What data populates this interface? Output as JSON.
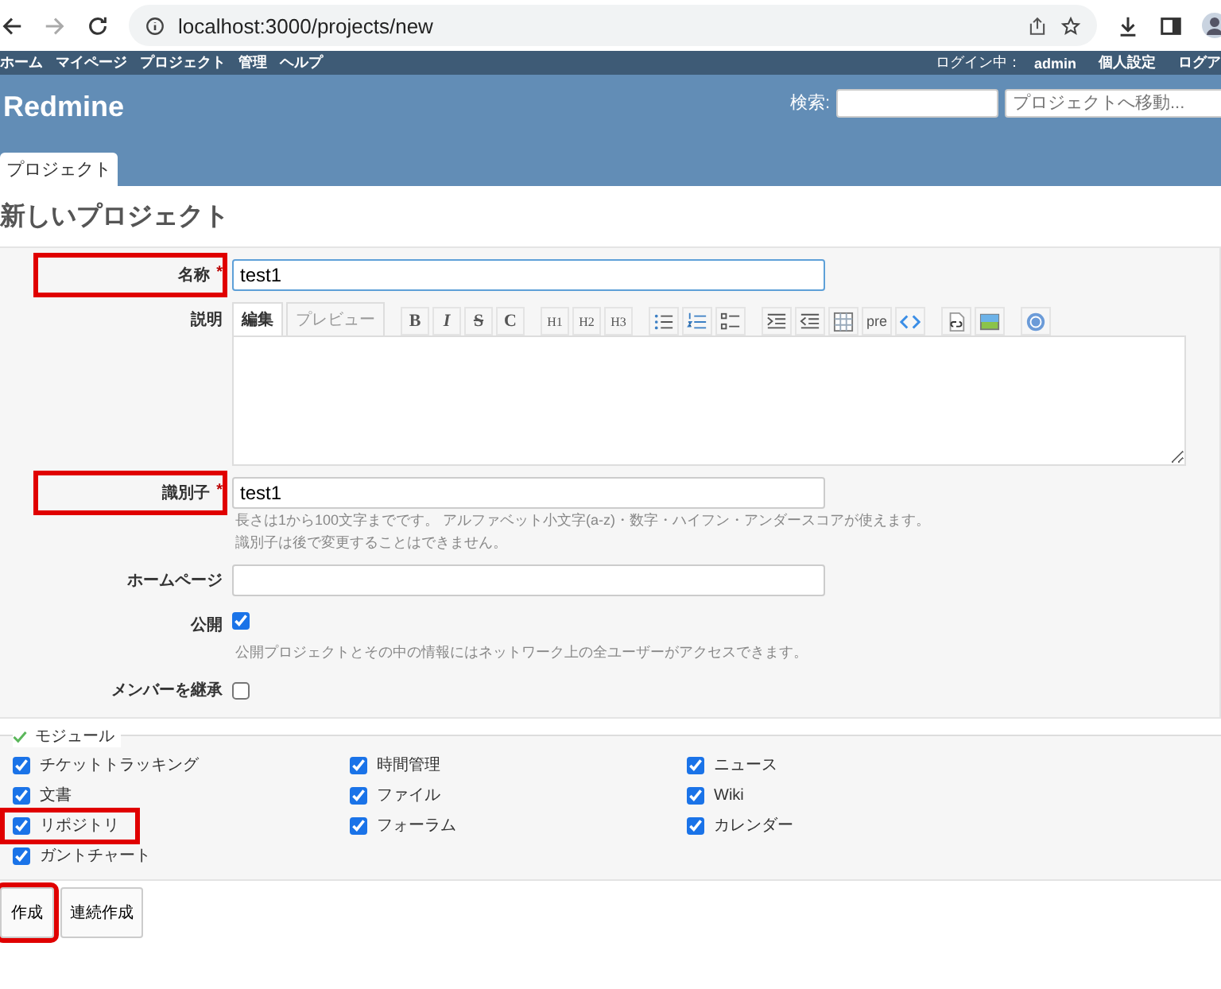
{
  "browser": {
    "url": "localhost:3000/projects/new"
  },
  "top_menu": {
    "items": [
      "ホーム",
      "マイページ",
      "プロジェクト",
      "管理",
      "ヘルプ"
    ],
    "login_label": "ログイン中：",
    "user": "admin",
    "account_links": [
      "個人設定",
      "ログア"
    ]
  },
  "header": {
    "title": "Redmine",
    "search_label": "検索:",
    "project_jump": {
      "placeholder": "プロジェクトへ移動..."
    }
  },
  "tabs": [
    {
      "label": "プロジェクト",
      "selected": true
    }
  ],
  "page_title": "新しいプロジェクト",
  "form": {
    "name": {
      "label": "名称",
      "required_mark": "*",
      "value": "test1",
      "highlighted": true
    },
    "description": {
      "label": "説明",
      "tabs": [
        {
          "label": "編集",
          "selected": true
        },
        {
          "label": "プレビュー",
          "selected": false
        }
      ],
      "toolbar": [
        "B",
        "I",
        "S",
        "C",
        "H1",
        "H2",
        "H3",
        "pre"
      ]
    },
    "identifier": {
      "label": "識別子",
      "required_mark": "*",
      "value": "test1",
      "highlighted": true,
      "hints": [
        "長さは1から100文字までです。 アルファベット小文字(a-z)・数字・ハイフン・アンダースコアが使えます。",
        "識別子は後で変更することはできません。"
      ]
    },
    "homepage": {
      "label": "ホームページ"
    },
    "public": {
      "label": "公開",
      "checked": true,
      "hint": "公開プロジェクトとその中の情報にはネットワーク上の全ユーザーがアクセスできます。"
    },
    "inherit_members": {
      "label": "メンバーを継承",
      "checked": false
    }
  },
  "modules": {
    "legend": "モジュール",
    "items": [
      {
        "label": "チケットトラッキング",
        "checked": true,
        "highlighted": false
      },
      {
        "label": "時間管理",
        "checked": true,
        "highlighted": false
      },
      {
        "label": "ニュース",
        "checked": true,
        "highlighted": false
      },
      {
        "label": "文書",
        "checked": true,
        "highlighted": false
      },
      {
        "label": "ファイル",
        "checked": true,
        "highlighted": false
      },
      {
        "label": "Wiki",
        "checked": true,
        "highlighted": false
      },
      {
        "label": "リポジトリ",
        "checked": true,
        "highlighted": true
      },
      {
        "label": "フォーラム",
        "checked": true,
        "highlighted": false
      },
      {
        "label": "カレンダー",
        "checked": true,
        "highlighted": false
      },
      {
        "label": "ガントチャート",
        "checked": true,
        "highlighted": false
      }
    ]
  },
  "buttons": [
    {
      "label": "作成",
      "highlighted": true
    },
    {
      "label": "連続作成",
      "highlighted": false
    }
  ]
}
